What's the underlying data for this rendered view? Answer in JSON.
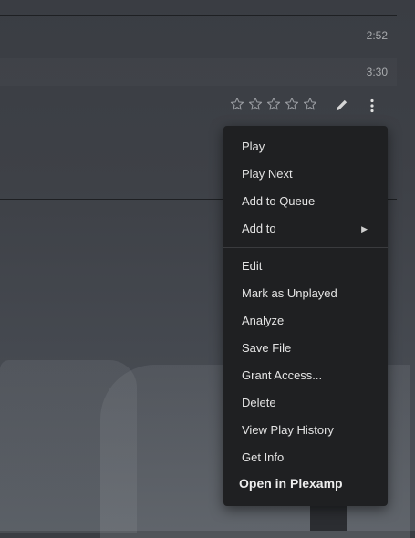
{
  "tracks": [
    {
      "duration": "2:52"
    },
    {
      "duration": "3:30"
    }
  ],
  "rating": {
    "stars": 5,
    "value": 0,
    "star_icon": "star-outline-icon"
  },
  "row_actions": {
    "edit_icon": "pencil-icon",
    "more_icon": "vertical-ellipsis-icon"
  },
  "context_menu": {
    "group1": [
      {
        "label": "Play"
      },
      {
        "label": "Play Next"
      },
      {
        "label": "Add to Queue"
      },
      {
        "label": "Add to",
        "submenu_icon": "triangle-right-icon",
        "submenu_glyph": "▶"
      }
    ],
    "group2": [
      {
        "label": "Edit"
      },
      {
        "label": "Mark as Unplayed"
      },
      {
        "label": "Analyze"
      },
      {
        "label": "Save File"
      },
      {
        "label": "Grant Access..."
      },
      {
        "label": "Delete"
      },
      {
        "label": "View Play History"
      },
      {
        "label": "Get Info"
      }
    ],
    "footer": {
      "label": "Open in Plexamp"
    }
  },
  "colors": {
    "menu_bg": "#1f2022",
    "menu_text": "#e3e3e3",
    "page_bg": "#3e4147",
    "duration_text": "#a9abae"
  }
}
